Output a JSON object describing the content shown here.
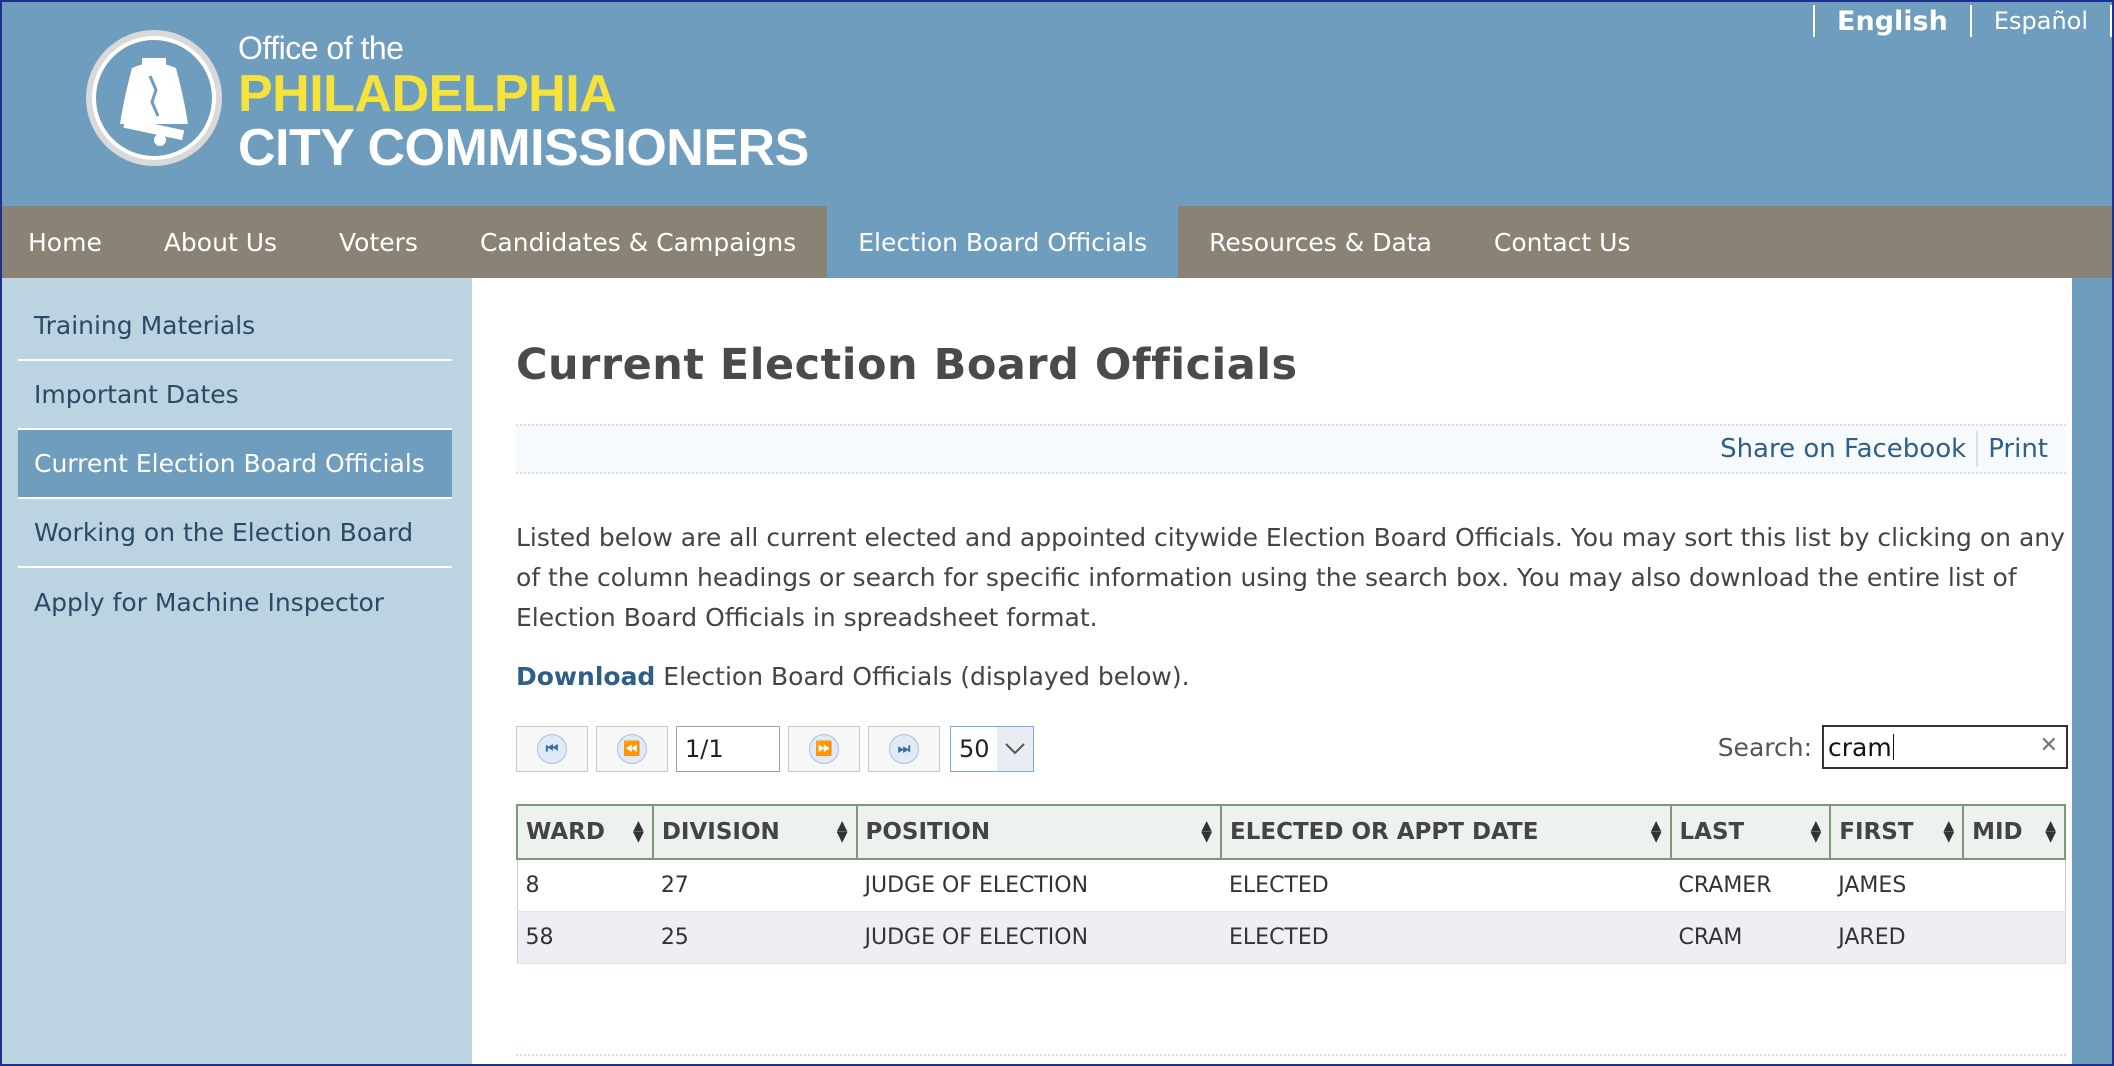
{
  "header": {
    "logo_line1": "Office of the",
    "logo_line2": "PHILADELPHIA",
    "logo_line3": "CITY COMMISSIONERS",
    "languages": [
      "English",
      "Español"
    ]
  },
  "nav": {
    "items": [
      "Home",
      "About Us",
      "Voters",
      "Candidates & Campaigns",
      "Election Board Officials",
      "Resources & Data",
      "Contact Us"
    ],
    "active": "Election Board Officials"
  },
  "sidebar": {
    "items": [
      "Training Materials",
      "Important Dates",
      "Current Election Board Officials",
      "Working on the Election Board",
      "Apply for Machine Inspector"
    ],
    "active": "Current Election Board Officials"
  },
  "main": {
    "title": "Current Election Board Officials",
    "share": {
      "facebook": "Share on Facebook",
      "print": "Print"
    },
    "intro": "Listed below are all current elected and appointed citywide Election Board Officials. You may sort this list by clicking on any of the column headings or search for specific information using the search box. You may also download the entire list of Election Board Officials in spreadsheet format.",
    "download_link": "Download",
    "download_text": " Election Board Officials (displayed below).",
    "pager": {
      "page": "1/1",
      "page_size": "50"
    },
    "search": {
      "label": "Search:",
      "value": "cram"
    },
    "table": {
      "columns": [
        "WARD",
        "DIVISION",
        "POSITION",
        "ELECTED OR APPT DATE",
        "LAST",
        "FIRST",
        "MID"
      ],
      "rows": [
        [
          "8",
          "27",
          "JUDGE OF ELECTION",
          "ELECTED",
          "CRAMER",
          "JAMES",
          ""
        ],
        [
          "58",
          "25",
          "JUDGE OF ELECTION",
          "ELECTED",
          "CRAM",
          "JARED",
          ""
        ]
      ]
    }
  },
  "colors": {
    "header_blue": "#6e9dbd",
    "nav_taupe": "#8a8274",
    "logo_yellow": "#f5e23a",
    "sidebar_bg": "#bcd3e1",
    "link_blue": "#2f5f86"
  },
  "icons": [
    "liberty-bell-icon",
    "first-page-icon",
    "prev-page-icon",
    "next-page-icon",
    "last-page-icon",
    "chevron-down-icon",
    "clear-icon",
    "sort-icon"
  ]
}
